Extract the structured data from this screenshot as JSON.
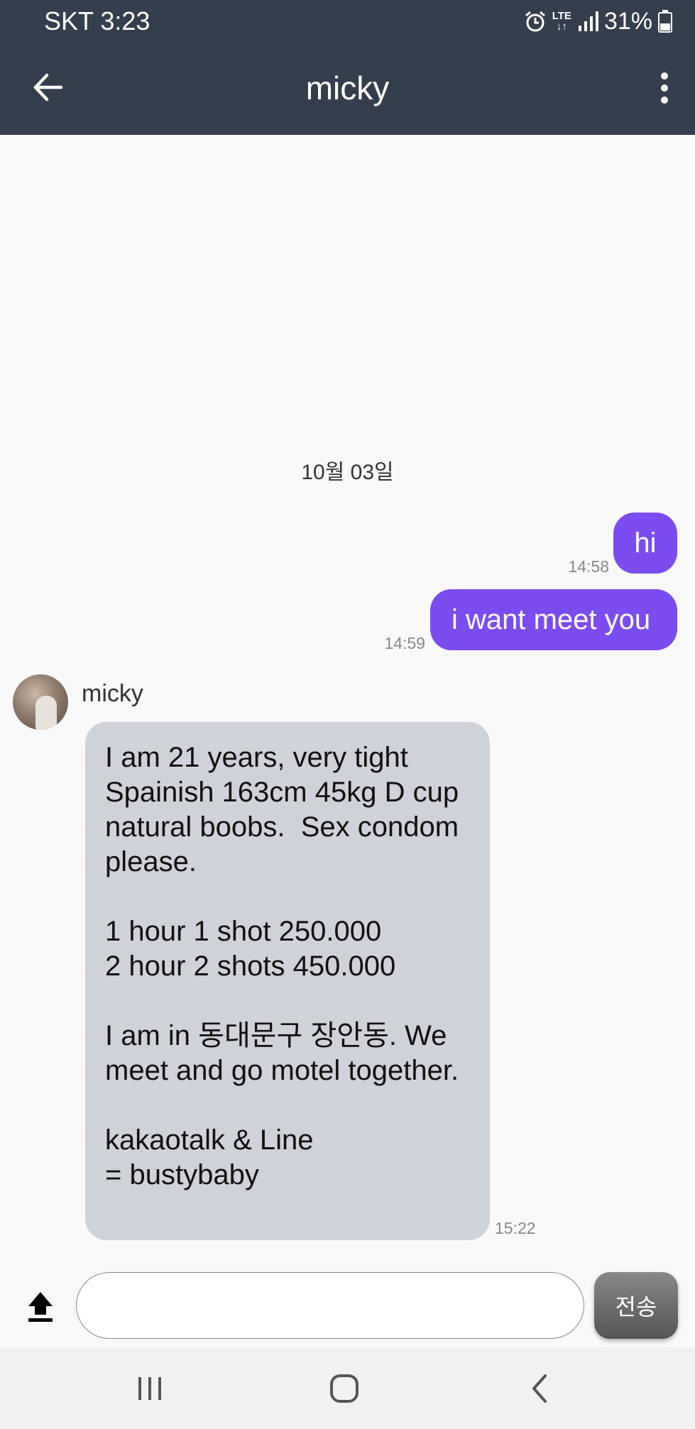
{
  "status_bar": {
    "carrier_time": "SKT 3:23",
    "network": "LTE",
    "battery": "31%",
    "icons": [
      "alarm-icon",
      "lte-icon",
      "signal-icon",
      "battery-icon"
    ]
  },
  "header": {
    "title": "micky",
    "background_color": "#343e4d"
  },
  "conversation": {
    "date_separator": "10월 03일",
    "outgoing": [
      {
        "text": "hi",
        "time": "14:58"
      },
      {
        "text": "i want meet you",
        "time": "14:59"
      }
    ],
    "incoming": {
      "sender": "micky",
      "text": "I am 21 years, very tight Spainish 163cm 45kg D cup natural boobs.  Sex condom please.\n\n1 hour 1 shot 250.000\n2 hour 2 shots 450.000\n\nI am in 동대문구 장안동. We meet and go motel together.\n\nkakaotalk & Line\n= bustybaby",
      "time": "15:22"
    }
  },
  "composer": {
    "input_value": "",
    "send_label": "전송"
  },
  "colors": {
    "outgoing_bubble": "#7b4cf0",
    "incoming_bubble": "#cfd2d8"
  },
  "nav_icons": [
    "recent-apps-icon",
    "home-icon",
    "back-icon"
  ]
}
